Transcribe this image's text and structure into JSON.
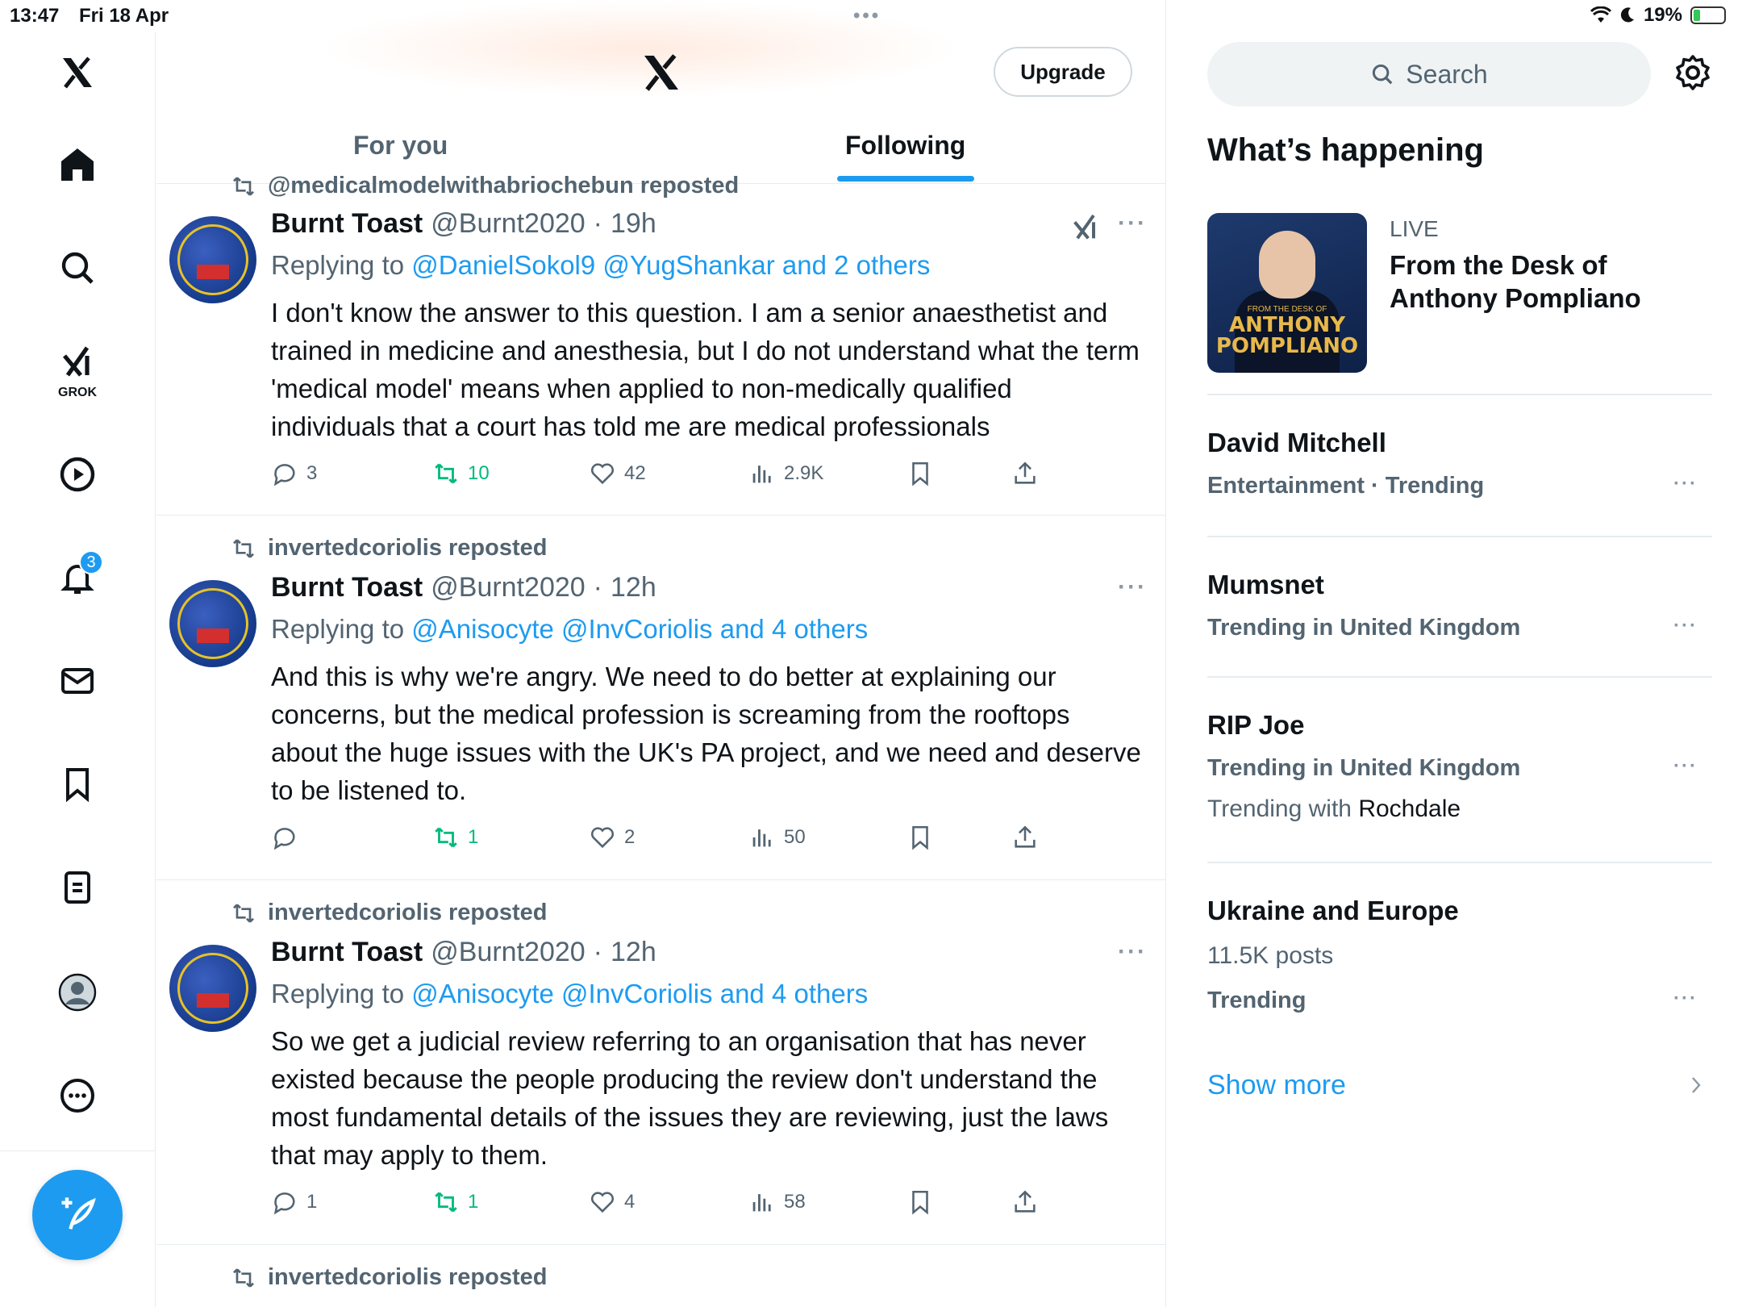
{
  "status_bar": {
    "time": "13:47",
    "date": "Fri 18 Apr",
    "battery": "19%"
  },
  "nav": {
    "grok_label": "GROK",
    "notifications_badge": "3"
  },
  "header": {
    "upgrade_label": "Upgrade"
  },
  "tabs": {
    "for_you": "For you",
    "following": "Following"
  },
  "posts": [
    {
      "repost_by": "@medicalmodelwithabriochebun reposted",
      "name": "Burnt Toast",
      "handle": "@Burnt2020",
      "sep": "·",
      "time": "19h",
      "replying_prefix": "Replying to",
      "replying_links": "@DanielSokol9 @YugShankar and 2 others",
      "text": "I don't know the answer to this question. I am a senior anaesthetist and trained in medicine and anesthesia, but I do not understand what the term 'medical model' means when applied to non-medically qualified individuals that a court has told me are medical professionals",
      "replies": "3",
      "reposts": "10",
      "likes": "42",
      "views": "2.9K"
    },
    {
      "repost_by": "invertedcoriolis reposted",
      "name": "Burnt Toast",
      "handle": "@Burnt2020",
      "sep": "·",
      "time": "12h",
      "replying_prefix": "Replying to",
      "replying_links": "@Anisocyte @InvCoriolis and 4 others",
      "text": "And this is why we're angry. We need to do better at explaining our concerns, but the medical profession is screaming from the rooftops about the huge issues with the UK's PA project, and we need and deserve to be listened to.",
      "replies": "",
      "reposts": "1",
      "likes": "2",
      "views": "50"
    },
    {
      "repost_by": "invertedcoriolis reposted",
      "name": "Burnt Toast",
      "handle": "@Burnt2020",
      "sep": "·",
      "time": "12h",
      "replying_prefix": "Replying to",
      "replying_links": "@Anisocyte @InvCoriolis and 4 others",
      "text": "So we get a judicial review referring to an organisation that has never existed because the people producing the review don't understand the most fundamental details of the issues they are reviewing, just the laws that may apply to them.",
      "replies": "1",
      "reposts": "1",
      "likes": "4",
      "views": "58"
    },
    {
      "repost_by": "invertedcoriolis reposted"
    }
  ],
  "sidebar": {
    "search_placeholder": "Search",
    "title": "What’s happening",
    "live": {
      "label": "LIVE",
      "title": "From the Desk of Anthony Pompliano",
      "thumb_small": "FROM THE DESK OF",
      "thumb_name": "ANTHONY POMPLIANO"
    },
    "trends": [
      {
        "title": "David Mitchell",
        "meta": "Entertainment · Trending"
      },
      {
        "title": "Mumsnet",
        "meta": "Trending in United Kingdom"
      },
      {
        "title": "RIP Joe",
        "meta": "Trending in United Kingdom",
        "with_prefix": "Trending with",
        "with_value": "Rochdale"
      },
      {
        "title": "Ukraine and Europe",
        "posts": "11.5K posts",
        "meta": "Trending"
      }
    ],
    "show_more": "Show more"
  },
  "colors": {
    "accent": "#1d9bf0",
    "repost_green": "#00ba7c",
    "muted": "#536471"
  }
}
